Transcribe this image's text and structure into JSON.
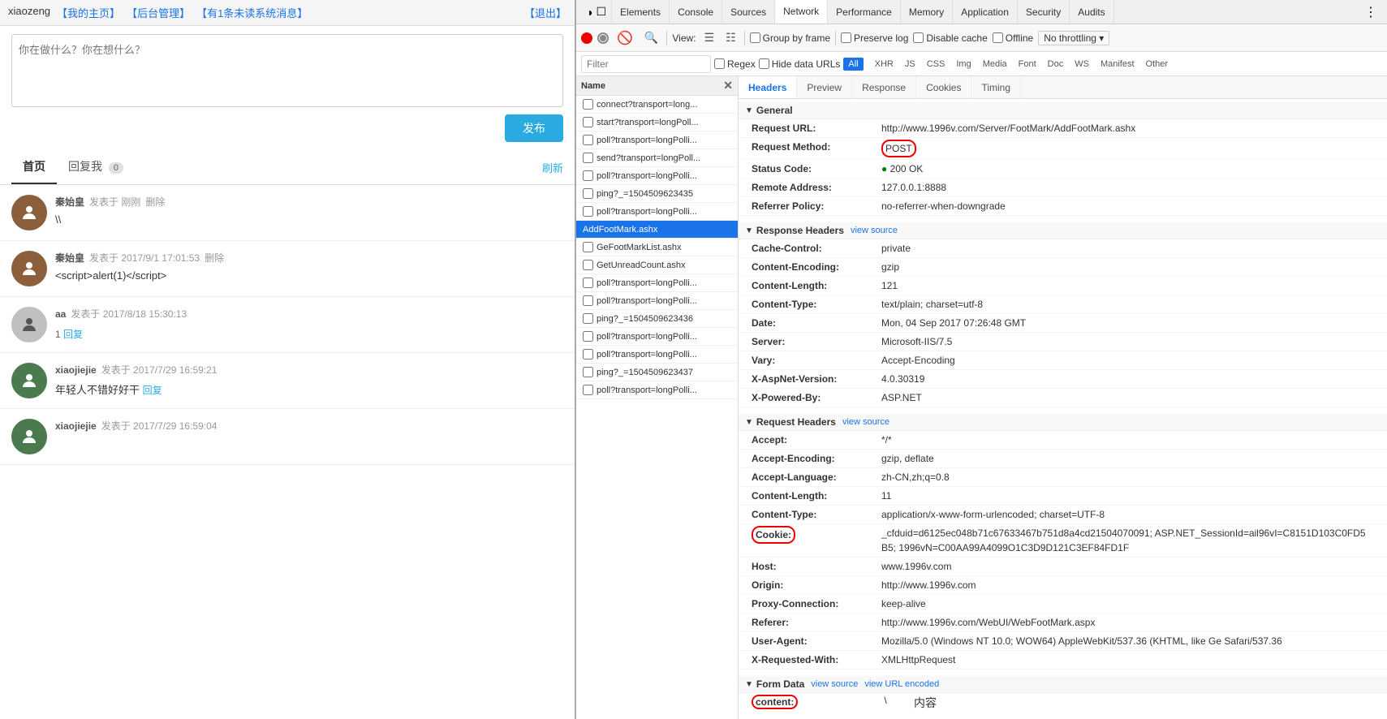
{
  "topbar": {
    "site": "xiaozeng",
    "links": [
      "我的主页",
      "后台管理",
      "有1条未读系统消息",
      "退出"
    ]
  },
  "compose": {
    "placeholder": "你在做什么？你在想什么？",
    "publish_label": "发布"
  },
  "nav": {
    "tabs": [
      {
        "label": "首页",
        "active": true
      },
      {
        "label": "回复我",
        "badge": "0"
      }
    ],
    "refresh": "刷新"
  },
  "posts": [
    {
      "id": 1,
      "author": "秦始皇",
      "time": "发表于 刚刚",
      "actions": [
        "删除"
      ],
      "body": "\\\\",
      "avatar_color": "#8B5E3C",
      "avatar_char": "👤"
    },
    {
      "id": 2,
      "author": "秦始皇",
      "time": "发表于 2017/9/1 17:01:53",
      "actions": [
        "删除"
      ],
      "body": "<script>alert(1)<\\/script>",
      "avatar_color": "#8B5E3C",
      "avatar_char": "👤"
    },
    {
      "id": 3,
      "author": "aa",
      "time": "发表于 2017/8/18 15:30:13",
      "reply_count": "1",
      "reply_label": "回复",
      "avatar_color": "#c0c0c0",
      "avatar_char": "👤"
    },
    {
      "id": 4,
      "author": "xiaojiejie",
      "time": "发表于 2017/7/29 16:59:21",
      "body": "年轻人不错好好干",
      "reply_label": "回复",
      "avatar_color": "#5a8a5e",
      "avatar_char": "👤"
    },
    {
      "id": 5,
      "author": "xiaojiejie",
      "time": "发表于 2017/7/29 16:59:04",
      "avatar_color": "#5a8a5e",
      "avatar_char": "👤"
    }
  ],
  "devtools": {
    "tabs": [
      "Elements",
      "Console",
      "Sources",
      "Network",
      "Performance",
      "Memory",
      "Application",
      "Security",
      "Audits"
    ],
    "active_tab": "Network",
    "toolbar": {
      "record_title": "Record",
      "stop_title": "Stop",
      "clear_title": "Clear",
      "filter_title": "Filter",
      "view_label": "View:",
      "group_by_frame": "Group by frame",
      "preserve_log": "Preserve log",
      "disable_cache": "Disable cache",
      "offline": "Offline",
      "no_throttling": "No throttling"
    },
    "filter_bar": {
      "placeholder": "Filter",
      "regex_label": "Regex",
      "hide_data_urls": "Hide data URLs",
      "all_label": "All",
      "types": [
        "XHR",
        "JS",
        "CSS",
        "Img",
        "Media",
        "Font",
        "Doc",
        "WS",
        "Manifest",
        "Other"
      ]
    },
    "request_list": {
      "header": "Name",
      "items": [
        {
          "name": "connect?transport=long...",
          "selected": false
        },
        {
          "name": "start?transport=longPoll...",
          "selected": false
        },
        {
          "name": "poll?transport=longPolli...",
          "selected": false
        },
        {
          "name": "send?transport=longPoll...",
          "selected": false
        },
        {
          "name": "poll?transport=longPolli...",
          "selected": false
        },
        {
          "name": "ping?_=1504509623435",
          "selected": false
        },
        {
          "name": "poll?transport=longPolli...",
          "selected": false
        },
        {
          "name": "AddFootMark.ashx",
          "selected": true
        },
        {
          "name": "GeFootMarkList.ashx",
          "selected": false
        },
        {
          "name": "GetUnreadCount.ashx",
          "selected": false
        },
        {
          "name": "poll?transport=longPolli...",
          "selected": false
        },
        {
          "name": "poll?transport=longPolli...",
          "selected": false
        },
        {
          "name": "ping?_=1504509623436",
          "selected": false
        },
        {
          "name": "poll?transport=longPolli...",
          "selected": false
        },
        {
          "name": "poll?transport=longPolli...",
          "selected": false
        },
        {
          "name": "ping?_=1504509623437",
          "selected": false
        },
        {
          "name": "poll?transport=longPolli...",
          "selected": false
        }
      ]
    },
    "detail": {
      "tabs": [
        "Headers",
        "Preview",
        "Response",
        "Cookies",
        "Timing"
      ],
      "active_tab": "Headers",
      "general": {
        "title": "General",
        "rows": [
          {
            "key": "Request URL:",
            "val": "http://www.1996v.com/Server/FootMark/AddFootMark.ashx"
          },
          {
            "key": "Request Method:",
            "val": "POST",
            "highlight": true
          },
          {
            "key": "Status Code:",
            "val": "200 OK",
            "status_green": true
          },
          {
            "key": "Remote Address:",
            "val": "127.0.0.1:8888"
          },
          {
            "key": "Referrer Policy:",
            "val": "no-referrer-when-downgrade"
          }
        ]
      },
      "response_headers": {
        "title": "Response Headers",
        "view_source": "view source",
        "rows": [
          {
            "key": "Cache-Control:",
            "val": "private"
          },
          {
            "key": "Content-Encoding:",
            "val": "gzip"
          },
          {
            "key": "Content-Length:",
            "val": "121"
          },
          {
            "key": "Content-Type:",
            "val": "text/plain; charset=utf-8"
          },
          {
            "key": "Date:",
            "val": "Mon, 04 Sep 2017 07:26:48 GMT"
          },
          {
            "key": "Server:",
            "val": "Microsoft-IIS/7.5"
          },
          {
            "key": "Vary:",
            "val": "Accept-Encoding"
          },
          {
            "key": "X-AspNet-Version:",
            "val": "4.0.30319"
          },
          {
            "key": "X-Powered-By:",
            "val": "ASP.NET"
          }
        ]
      },
      "request_headers": {
        "title": "Request Headers",
        "view_source": "view source",
        "rows": [
          {
            "key": "Accept:",
            "val": "*/*"
          },
          {
            "key": "Accept-Encoding:",
            "val": "gzip, deflate"
          },
          {
            "key": "Accept-Language:",
            "val": "zh-CN,zh;q=0.8"
          },
          {
            "key": "Content-Length:",
            "val": "11"
          },
          {
            "key": "Content-Type:",
            "val": "application/x-www-form-urlencoded; charset=UTF-8"
          },
          {
            "key": "Cookie:",
            "val": "_cfduid=d6125ec048b71c67633467b751d8a4cd21504070091; ASP.NET_SessionId=ail96vI=C8151D103C0FD5B5; 1996vN=C00AA99A4099O1C3D9D121C3EF84FD1F",
            "highlight": true
          },
          {
            "key": "Host:",
            "val": "www.1996v.com"
          },
          {
            "key": "Origin:",
            "val": "http://www.1996v.com"
          },
          {
            "key": "Proxy-Connection:",
            "val": "keep-alive"
          },
          {
            "key": "Referer:",
            "val": "http://www.1996v.com/WebUI/WebFootMark.aspx"
          },
          {
            "key": "User-Agent:",
            "val": "Mozilla/5.0 (Windows NT 10.0; WOW64) AppleWebKit/537.36 (KHTML, like Ge Safari/537.36"
          },
          {
            "key": "X-Requested-With:",
            "val": "XMLHttpRequest"
          }
        ]
      },
      "form_data": {
        "title": "Form Data",
        "view_source": "view source",
        "view_url_encoded": "view URL encoded",
        "rows": [
          {
            "key": "content:",
            "val": "\\",
            "highlight": true
          }
        ],
        "label": "内容"
      }
    }
  }
}
